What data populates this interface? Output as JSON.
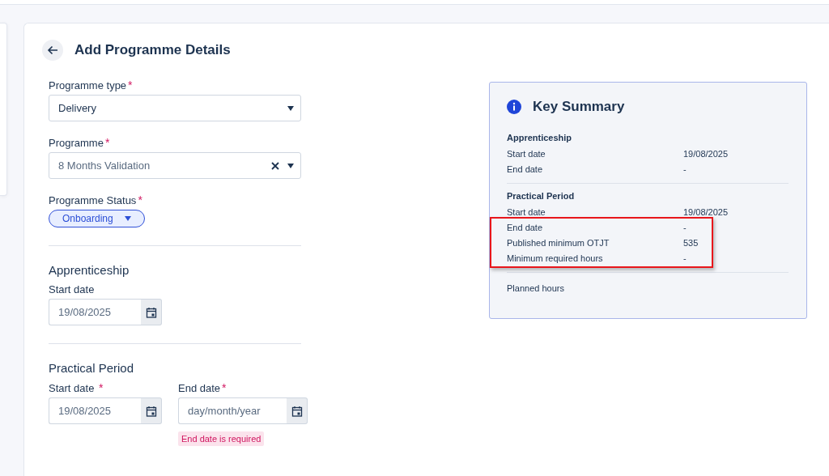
{
  "page": {
    "title": "Add Programme Details"
  },
  "form": {
    "fields": [
      {
        "kind": "select",
        "label": "Programme type",
        "required_mark": "*",
        "value": "Delivery"
      },
      {
        "kind": "combobox",
        "label": "Programme",
        "required_mark": "*",
        "value": "8 Months Validation"
      },
      {
        "kind": "pill",
        "label": "Programme Status",
        "required_mark": "*",
        "value": "Onboarding"
      }
    ],
    "sections": [
      {
        "heading": "Apprenticeship",
        "dates": [
          {
            "label": "Start date",
            "value": "19/08/2025"
          }
        ]
      },
      {
        "heading": "Practical Period",
        "dates": [
          {
            "label": "Start date",
            "required_mark": "*",
            "value": "19/08/2025"
          },
          {
            "label": "End date",
            "required_mark": "*",
            "placeholder": "day/month/year",
            "error": "End date is required"
          }
        ]
      }
    ]
  },
  "summary": {
    "title": "Key Summary",
    "sections": [
      {
        "heading": "Apprenticeship",
        "rows": [
          {
            "label": "Start date",
            "value": "19/08/2025",
            "highlighted": false
          },
          {
            "label": "End date",
            "value": "-",
            "highlighted": false
          }
        ]
      },
      {
        "heading": "Practical Period",
        "rows": [
          {
            "label": "Start date",
            "value": "19/08/2025",
            "highlighted": false
          },
          {
            "label": "End date",
            "value": "-",
            "highlighted": true
          },
          {
            "label": "Published minimum OTJT",
            "value": "535",
            "highlighted": true
          },
          {
            "label": "Minimum required hours",
            "value": "-",
            "highlighted": true
          }
        ]
      },
      {
        "rows": [
          {
            "label": "Planned hours",
            "highlighted": false
          }
        ]
      }
    ]
  }
}
